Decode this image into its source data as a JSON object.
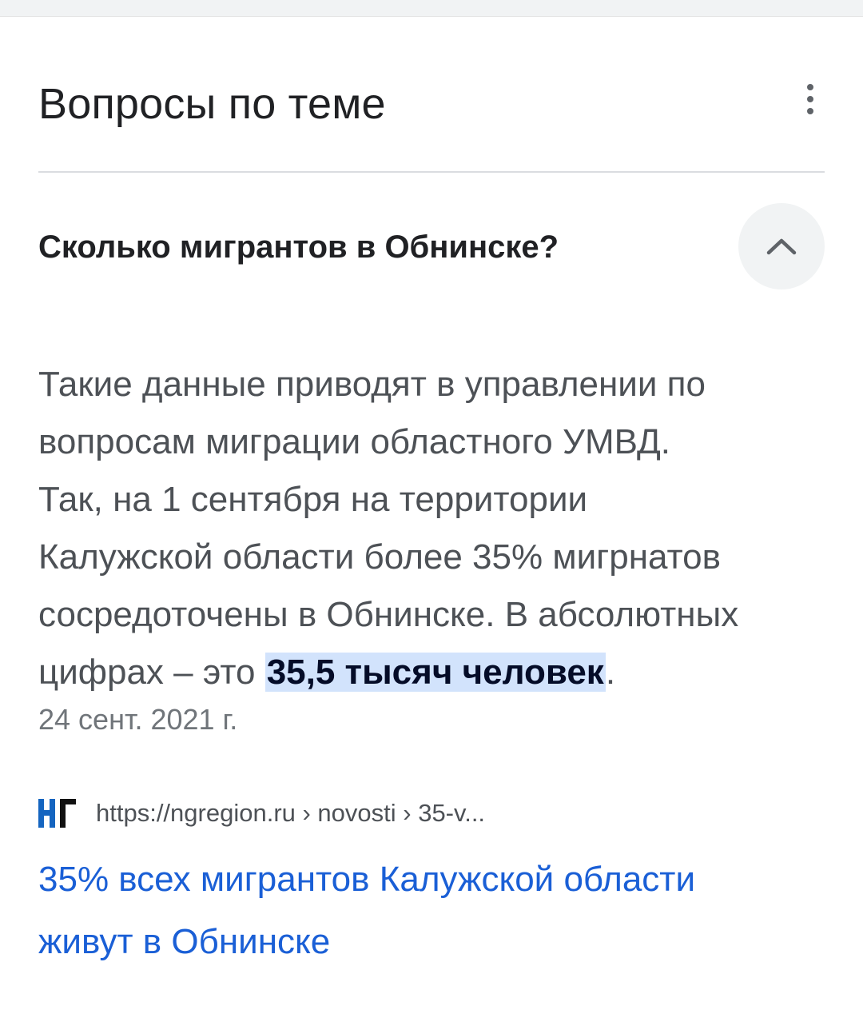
{
  "section": {
    "title": "Вопросы по теме",
    "more_icon": "more-vert-icon"
  },
  "question": {
    "text": "Сколько мигрантов в Обнинске?",
    "toggle_icon": "chevron-up-icon",
    "expanded": true
  },
  "answer": {
    "lines": [
      "Такие данные приводят в управлении по",
      "вопросам миграции областного УМВД.",
      "Так, на 1 сентября на территории",
      "Калужской области более 35% мигрнатов",
      "сосредоточены в Обнинске. В абсолютных"
    ],
    "last_line_prefix": "цифрах – это ",
    "highlight": "35,5 тысяч человек",
    "last_line_suffix": ".",
    "date": "24 сент. 2021 г."
  },
  "source": {
    "favicon_icon": "ng-logo-icon",
    "url": "https://ngregion.ru › novosti › 35-v..."
  },
  "result": {
    "title_line1": "35% всех мигрантов Калужской области",
    "title_line2": "живут в Обнинске"
  },
  "colors": {
    "title_text": "#202124",
    "answer_text": "#4d5156",
    "highlight_bg": "#d2e3fc",
    "link": "#1a5fd6",
    "logo_blue": "#1565c0"
  }
}
